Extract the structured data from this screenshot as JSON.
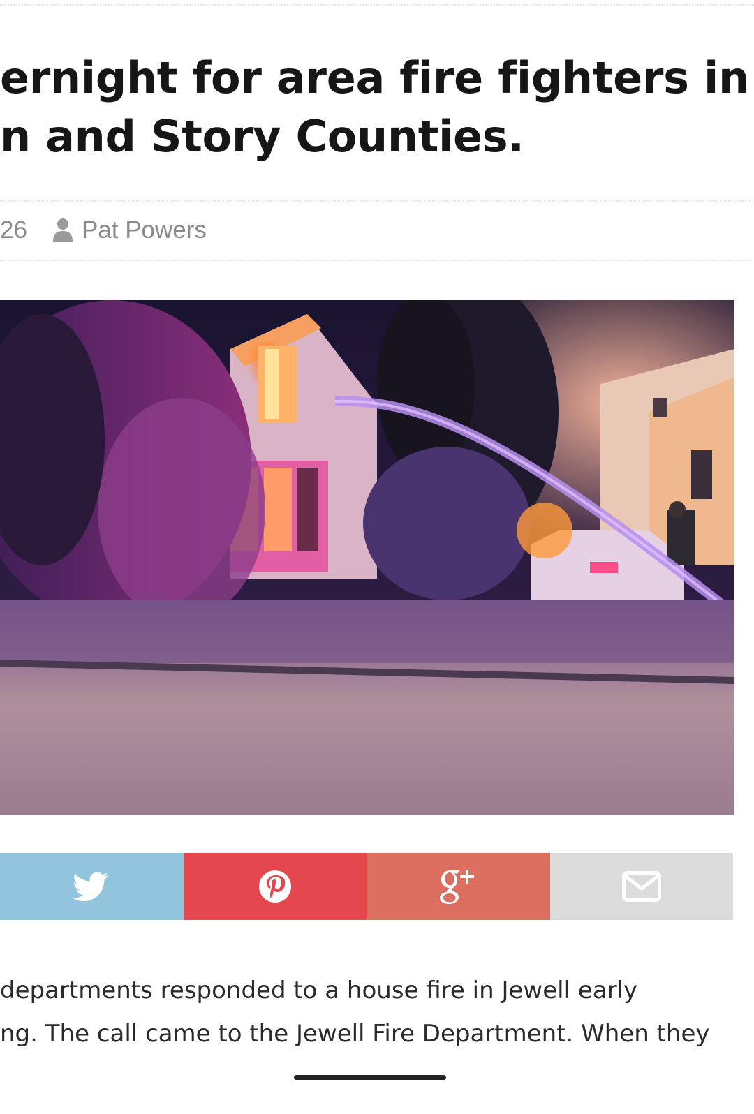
{
  "article": {
    "headline_lines": [
      "ernight for area fire fighters in",
      "n and Story Counties."
    ],
    "meta": {
      "date_fragment": "26",
      "author_icon": "user-icon",
      "author": "Pat Powers"
    },
    "body_lines": [
      " departments responded to a house fire in Jewell early",
      "ng. The call came to the Jewell Fire Department. When they"
    ]
  },
  "share": {
    "buttons": [
      {
        "network": "twitter",
        "icon": "twitter-icon",
        "color": "#93c4dd"
      },
      {
        "network": "pinterest",
        "icon": "pinterest-icon",
        "color": "#e4474d"
      },
      {
        "network": "google-plus",
        "icon": "google-plus-icon",
        "color": "#dd6f60"
      },
      {
        "network": "email",
        "icon": "envelope-icon",
        "color": "#dcdcdc"
      }
    ]
  },
  "colors": {
    "headline": "#161616",
    "meta": "#8a8a8a",
    "body": "#2a2a2a"
  }
}
